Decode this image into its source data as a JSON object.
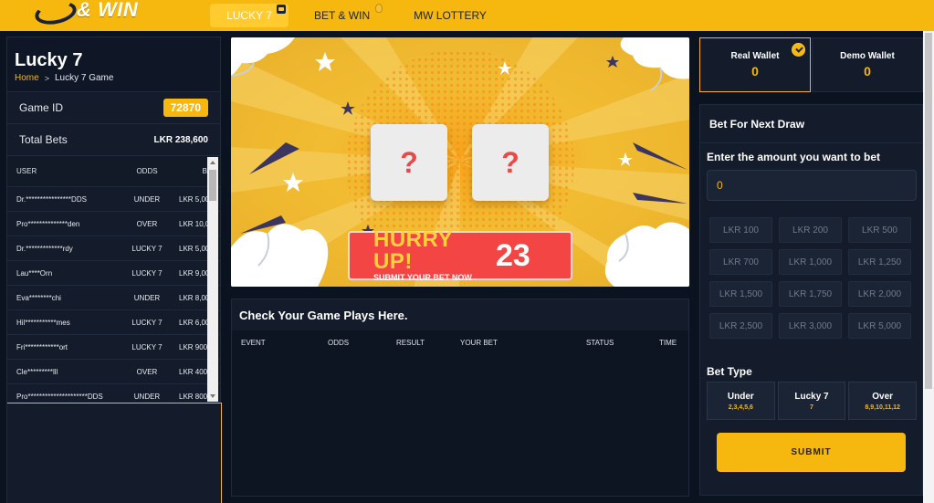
{
  "brand": {
    "logo_text": "& WIN"
  },
  "nav": [
    {
      "label": "LUCKY 7",
      "active": true,
      "icon": "game-icon"
    },
    {
      "label": "BET & WIN",
      "active": false,
      "icon": "fire-icon"
    },
    {
      "label": "MW LOTTERY",
      "active": false
    }
  ],
  "left": {
    "title": "Lucky 7",
    "breadcrumb": {
      "home": "Home",
      "current": "Lucky 7 Game"
    },
    "game_id_label": "Game ID",
    "game_id": "72870",
    "total_bets_label": "Total Bets",
    "total_bets": "LKR 238,600",
    "table": {
      "headers": {
        "user": "USER",
        "odds": "ODDS",
        "bet": "B"
      },
      "rows": [
        {
          "user": "Dr.****************DDS",
          "odds": "UNDER",
          "bet": "LKR 5,00"
        },
        {
          "user": "Pro**************den",
          "odds": "OVER",
          "bet": "LKR 10,0"
        },
        {
          "user": "Dr.*************rdy",
          "odds": "LUCKY 7",
          "bet": "LKR 5,00"
        },
        {
          "user": "Lau****Orn",
          "odds": "LUCKY 7",
          "bet": "LKR 9,00"
        },
        {
          "user": "Eva********chi",
          "odds": "UNDER",
          "bet": "LKR 8,00"
        },
        {
          "user": "Hil***********mes",
          "odds": "LUCKY 7",
          "bet": "LKR 6,00"
        },
        {
          "user": "Fri************ort",
          "odds": "LUCKY 7",
          "bet": "LKR 900"
        },
        {
          "user": "Cle*********lll",
          "odds": "OVER",
          "bet": "LKR 400"
        },
        {
          "user": "Pro*********************DDS",
          "odds": "UNDER",
          "bet": "LKR 800"
        }
      ]
    }
  },
  "game": {
    "dice": [
      "?",
      "?"
    ],
    "hurry_title": "HURRY UP!",
    "hurry_sub": "SUBMIT YOUR BET NOW",
    "countdown": "23"
  },
  "plays": {
    "title": "Check Your Game Plays Here.",
    "headers": [
      "EVENT",
      "ODDS",
      "RESULT",
      "YOUR BET",
      "STATUS",
      "TIME"
    ]
  },
  "wallets": {
    "real": {
      "label": "Real Wallet",
      "value": "0"
    },
    "demo": {
      "label": "Demo Wallet",
      "value": "0"
    }
  },
  "bet": {
    "title": "Bet For Next Draw",
    "prompt": "Enter the amount you want to bet",
    "amount": "0",
    "chips": [
      "LKR 100",
      "LKR 200",
      "LKR 500",
      "LKR 700",
      "LKR 1,000",
      "LKR 1,250",
      "LKR 1,500",
      "LKR 1,750",
      "LKR 2,000",
      "LKR 2,500",
      "LKR 3,000",
      "LKR 5,000"
    ],
    "type_label": "Bet Type",
    "types": [
      {
        "name": "Under",
        "nums": "2,3,4,5,6"
      },
      {
        "name": "Lucky 7",
        "nums": "7"
      },
      {
        "name": "Over",
        "nums": "8,9,10,11,12"
      }
    ],
    "submit_label": "SUBMIT"
  },
  "colors": {
    "accent": "#f6b70e",
    "background": "#0b1220",
    "panel": "#141c2b",
    "hurry": "#f44545"
  }
}
